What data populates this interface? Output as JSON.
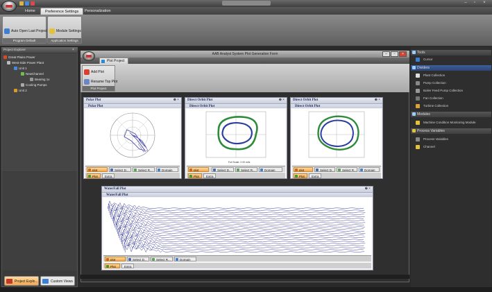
{
  "app": {
    "ribbon_tabs": [
      "Home",
      "Preference Settings",
      "Personalization"
    ],
    "active_tab_index": 1
  },
  "ribbon": {
    "auto_open_label": "Auto Open Last Project",
    "module_settings_label": "Module Settings",
    "group_program_default": "Program Default",
    "group_application_settings": "Application Settings"
  },
  "project_explorer": {
    "title": "Project Explorer",
    "tree": [
      {
        "label": "Great Plains Power",
        "level": 0
      },
      {
        "label": "West-Side Power Plant",
        "level": 1
      },
      {
        "label": "Unit 1",
        "level": 2
      },
      {
        "label": "NewChannel",
        "level": 3
      },
      {
        "label": "Bearing 1x",
        "level": 4
      },
      {
        "label": "Cooling Pumps",
        "level": 3
      },
      {
        "label": "Unit 2",
        "level": 2
      }
    ],
    "bottom_tabs": [
      "Project Explo...",
      "Custom Views"
    ]
  },
  "document": {
    "title": "AAB Analyst System Plot Generation Form",
    "tab_label": "Plot Project",
    "add_plot_label": "Add Plot",
    "rename_top_plot_label": "Rename Top Plot",
    "group_label": "Plot Project"
  },
  "plots": {
    "polar": {
      "title": "Polar Plot",
      "subtitle": "Polar Plot"
    },
    "orbit1": {
      "title": "Direct Orbit Plot",
      "subtitle": "Direct Orbit Plot",
      "scale_text": "Full Scale: 2.00 mils"
    },
    "orbit2": {
      "title": "Direct Orbit Plot",
      "subtitle": "Direct Orbit Plot"
    },
    "waterfall": {
      "title": "WaterFall Plot",
      "subtitle": "WaterFall Plot"
    },
    "toolbar": {
      "plot": "plot",
      "select_d": "Select D...",
      "select_r": "Select R...",
      "domain": "Domain"
    },
    "tabs": {
      "plot": "Plot",
      "extra": "Extra"
    }
  },
  "right_panel": {
    "tools_header": "Tools",
    "tools_items": [
      "Cursor"
    ],
    "dividers_header": "Dividers",
    "dividers_items": [
      "Plant Collection",
      "Pump Collection",
      "Boiler Feed Pump Collection",
      "Fan Collection",
      "Turbine Collection"
    ],
    "modules_header": "Modules",
    "modules_items": [
      "Machine Condition Monitoring Module"
    ],
    "process_header": "Process Variables",
    "process_items": [
      "Process Variables",
      "Channel"
    ]
  }
}
